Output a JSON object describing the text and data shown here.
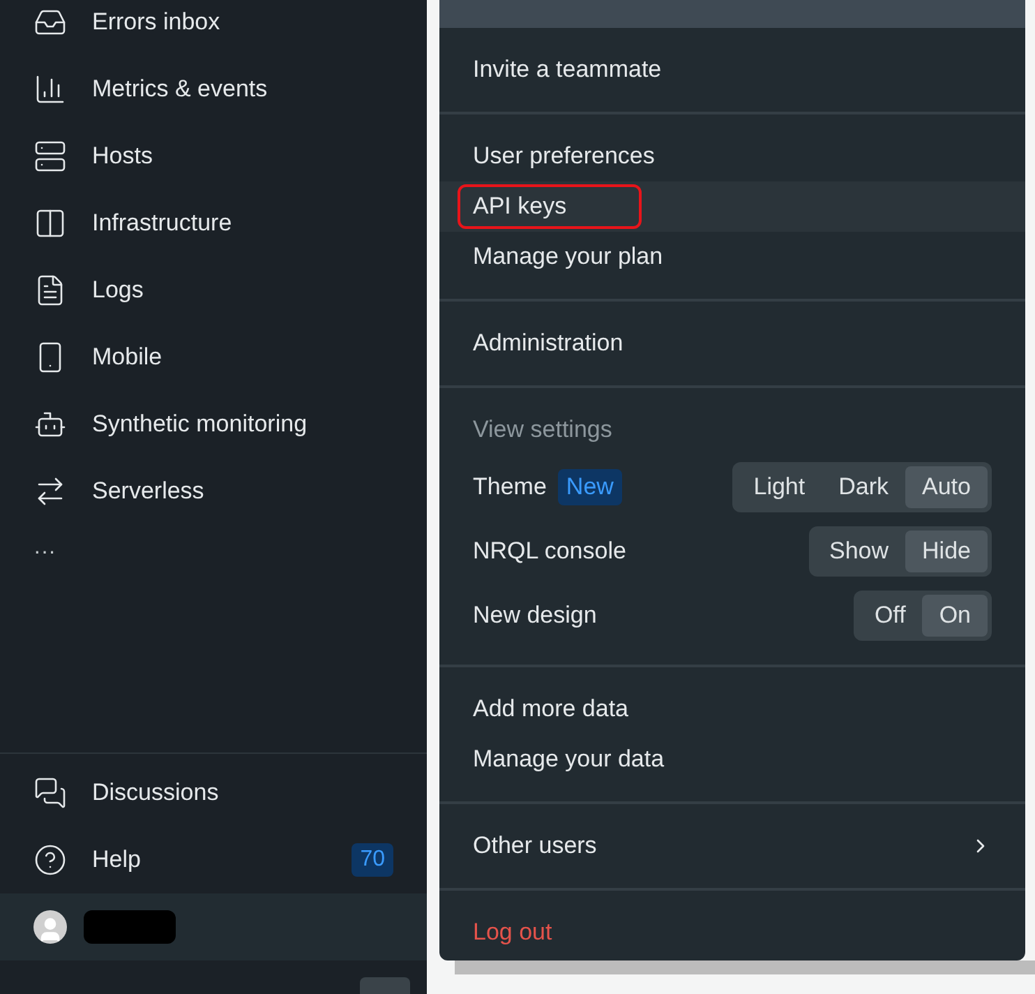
{
  "sidebar": {
    "items": [
      {
        "label": "Errors inbox"
      },
      {
        "label": "Metrics & events"
      },
      {
        "label": "Hosts"
      },
      {
        "label": "Infrastructure"
      },
      {
        "label": "Logs"
      },
      {
        "label": "Mobile"
      },
      {
        "label": "Synthetic monitoring"
      },
      {
        "label": "Serverless"
      }
    ],
    "more": "···",
    "bottom_items": [
      {
        "label": "Discussions"
      },
      {
        "label": "Help",
        "badge": "70"
      }
    ],
    "user": {
      "redacted": true
    }
  },
  "menu": {
    "groups": [
      {
        "items": [
          {
            "kind": "link",
            "label": "Invite a teammate",
            "hovered": false,
            "annotated": false
          }
        ]
      },
      {
        "items": [
          {
            "kind": "link",
            "label": "User preferences",
            "hovered": false,
            "annotated": false
          },
          {
            "kind": "link",
            "label": "API keys",
            "hovered": true,
            "annotated": true
          },
          {
            "kind": "link",
            "label": "Manage your plan",
            "hovered": false,
            "annotated": false
          }
        ]
      },
      {
        "items": [
          {
            "kind": "link",
            "label": "Administration",
            "hovered": false,
            "annotated": false
          }
        ]
      },
      {
        "items": [
          {
            "kind": "heading",
            "label": "View settings"
          },
          {
            "kind": "toggle",
            "label": "Theme",
            "badge": "New",
            "options": [
              {
                "label": "Light",
                "selected": false
              },
              {
                "label": "Dark",
                "selected": false
              },
              {
                "label": "Auto",
                "selected": true
              }
            ]
          },
          {
            "kind": "toggle",
            "label": "NRQL console",
            "options": [
              {
                "label": "Show",
                "selected": false
              },
              {
                "label": "Hide",
                "selected": true
              }
            ]
          },
          {
            "kind": "toggle",
            "label": "New design",
            "options": [
              {
                "label": "Off",
                "selected": false
              },
              {
                "label": "On",
                "selected": true
              }
            ]
          }
        ]
      },
      {
        "items": [
          {
            "kind": "link",
            "label": "Add more data",
            "hovered": false,
            "annotated": false
          },
          {
            "kind": "link",
            "label": "Manage your data",
            "hovered": false,
            "annotated": false
          }
        ]
      },
      {
        "items": [
          {
            "kind": "submenu",
            "label": "Other users"
          }
        ]
      },
      {
        "items": [
          {
            "kind": "danger",
            "label": "Log out"
          }
        ]
      }
    ]
  }
}
